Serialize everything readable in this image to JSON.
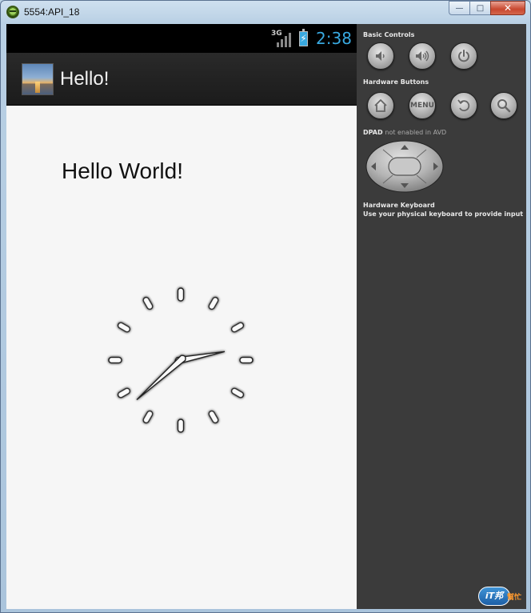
{
  "window": {
    "title": "5554:API_18",
    "controls": {
      "minimize": "—",
      "maximize": "□",
      "close": "✕"
    }
  },
  "statusbar": {
    "network": "3G",
    "time": "2:38",
    "accent_color": "#39a9e0"
  },
  "actionbar": {
    "title": "Hello!"
  },
  "content": {
    "hello_text": "Hello World!",
    "analog_clock": {
      "hours": 2,
      "minutes": 38
    }
  },
  "panel": {
    "basic_controls_label": "Basic Controls",
    "basic_controls": [
      {
        "name": "volume-down",
        "icon": "volume-down-icon"
      },
      {
        "name": "volume-up",
        "icon": "volume-up-icon"
      },
      {
        "name": "power",
        "icon": "power-icon"
      }
    ],
    "hardware_buttons_label": "Hardware Buttons",
    "hardware_buttons": [
      {
        "name": "home",
        "icon": "home-icon"
      },
      {
        "name": "menu",
        "label": "MENU"
      },
      {
        "name": "back",
        "icon": "back-icon"
      },
      {
        "name": "search",
        "icon": "search-icon"
      }
    ],
    "dpad_label": "DPAD",
    "dpad_note": "not enabled in AVD",
    "keyboard_label": "Hardware Keyboard",
    "keyboard_desc": "Use your physical keyboard to provide input"
  },
  "watermark": {
    "main": "iT邦",
    "sub": "幫忙"
  }
}
